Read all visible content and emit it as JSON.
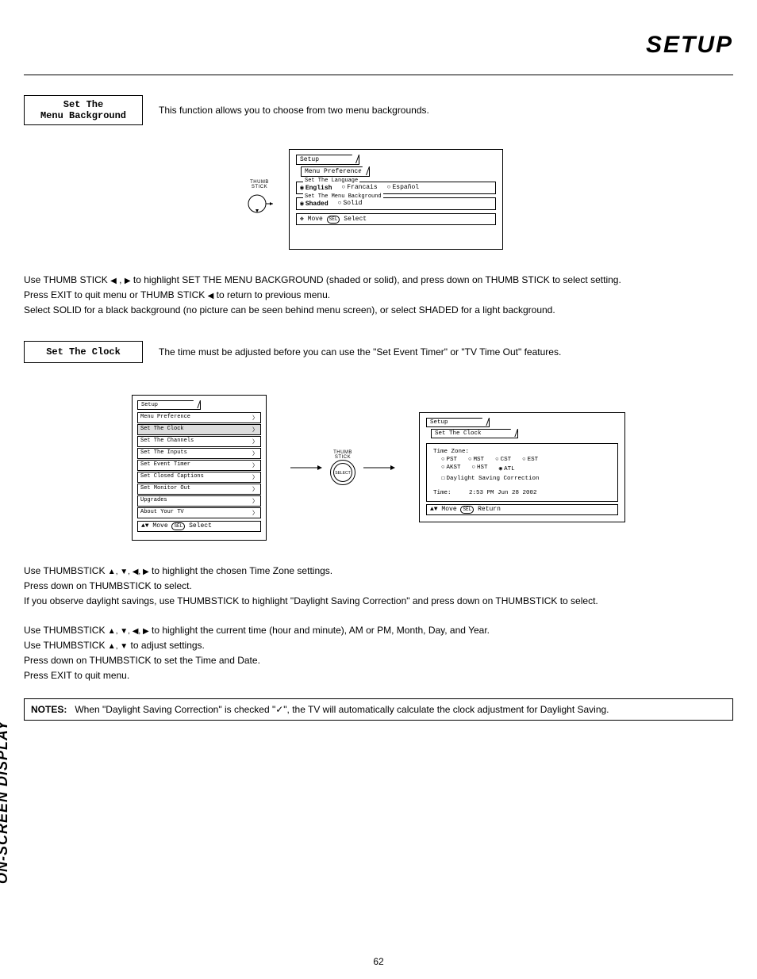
{
  "page": {
    "title": "SETUP",
    "spine": "ON-SCREEN DISPLAY",
    "number": "62"
  },
  "section1": {
    "heading_l1": "Set The",
    "heading_l2": "Menu Background",
    "intro": "This function allows you to choose from two menu backgrounds."
  },
  "thumbstick": {
    "label": "THUMB\nSTICK",
    "select_label": "SELECT"
  },
  "osd1": {
    "tab1": "Setup",
    "tab2": "Menu Preferences",
    "group1": {
      "legend": "Set The Language",
      "opts": [
        "English",
        "Francais",
        "Español"
      ],
      "selected": 0
    },
    "group2": {
      "legend": "Set The Menu Background",
      "opts": [
        "Shaded",
        "Solid"
      ],
      "selected": 0
    },
    "hint_move": "Move",
    "hint_sel": "SEL",
    "hint_select": "Select"
  },
  "body1": {
    "p1_a": "Use THUMB STICK ",
    "p1_b": " , ",
    "p1_c": " to highlight SET THE MENU BACKGROUND (shaded or solid), and press down on THUMB STICK to select setting.",
    "p2_a": "Press EXIT to quit menu or THUMB STICK ",
    "p2_b": " to return to previous menu.",
    "p3": "Select SOLID for a black background (no picture can be seen behind menu screen), or select SHADED for a light background."
  },
  "section2": {
    "heading": "Set The Clock",
    "intro": "The time must be adjusted before you can use the \"Set Event Timer\" or \"TV Time Out\" features."
  },
  "osd_list": {
    "tab": "Setup",
    "items": [
      "Menu Preference",
      "Set The Clock",
      "Set The Channels",
      "Set The Inputs",
      "Set Event Timer",
      "Set Closed Captions",
      "Set Monitor Out",
      "Upgrades",
      "About Your TV"
    ],
    "highlight_index": 1,
    "hint_move": "Move",
    "hint_sel": "SEL",
    "hint_select": "Select"
  },
  "osd_clock": {
    "tab1": "Setup",
    "tab2": "Set The Clock",
    "tz_label": "Time Zone:",
    "tz_row1": [
      "PST",
      "MST",
      "CST",
      "EST"
    ],
    "tz_row2": [
      "AKST",
      "HST",
      "ATL"
    ],
    "tz_selected": "ATL",
    "dst": "Daylight Saving Correction",
    "time_label": "Time:",
    "time_value": "2:53 PM Jun 28 2002",
    "hint_move": "Move",
    "hint_sel": "SEL",
    "hint_return": "Return"
  },
  "body2": {
    "p1_a": "Use THUMBSTICK ",
    "p1_b": " to highlight the chosen Time Zone settings.",
    "p2": "Press down on THUMBSTICK to select.",
    "p3": "If you observe daylight savings, use THUMBSTICK to highlight \"Daylight Saving Correction\" and press down on THUMBSTICK to select.",
    "p4_a": "Use THUMBSTICK ",
    "p4_b": " to highlight the current time (hour and minute), AM or PM, Month, Day, and Year.",
    "p5_a": "Use THUMBSTICK ",
    "p5_b": " to adjust settings.",
    "p6": "Press down on THUMBSTICK to set the Time and Date.",
    "p7": "Press EXIT to quit menu."
  },
  "notes": {
    "label": "NOTES:",
    "text": "When \"Daylight Saving Correction\" is checked \"✓\", the TV will automatically calculate the clock adjustment for Daylight Saving."
  },
  "glyph": {
    "left": "◀",
    "right": "▶",
    "up": "▲",
    "down": "▼",
    "updown": "▲▼",
    "all": "▲, ▼, ◀, ▶",
    "ud": "▲, ▼",
    "joy": "✥"
  }
}
